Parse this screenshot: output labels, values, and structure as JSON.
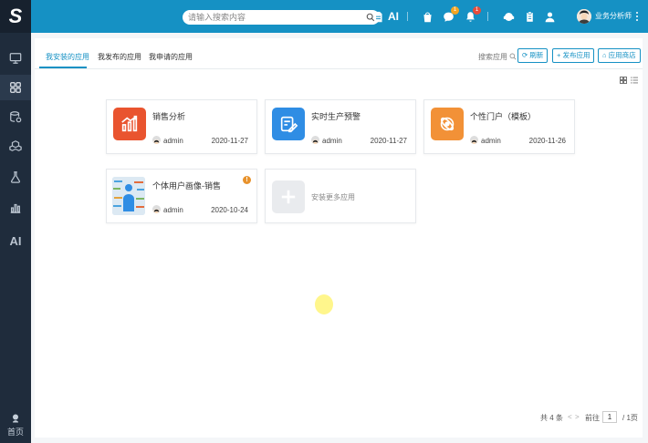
{
  "app": {
    "logo": "S"
  },
  "sidebar": {
    "items": [
      {
        "icon": "monitor-icon"
      },
      {
        "icon": "apps-grid-icon",
        "active": true
      },
      {
        "icon": "database-icon"
      },
      {
        "icon": "cubes-icon"
      },
      {
        "icon": "flask-icon"
      },
      {
        "icon": "bar-chart-icon"
      },
      {
        "icon": "ai-icon",
        "label": "AI"
      }
    ],
    "footer_label": "首页"
  },
  "topbar": {
    "search_placeholder": "请输入搜索内容",
    "ai_label": "AI",
    "message_badge": "1",
    "alert_badge": "1",
    "user_name": "业务分析师"
  },
  "tabs": [
    {
      "label": "我安装的应用",
      "active": true
    },
    {
      "label": "我发布的应用"
    },
    {
      "label": "我申请的应用"
    }
  ],
  "toolbar": {
    "search_label": "搜索应用",
    "refresh_label": "刷新",
    "publish_label": "+ 发布应用",
    "store_label": "应用商店"
  },
  "apps": [
    {
      "name": "销售分析",
      "owner": "admin",
      "date": "2020-11-27",
      "color": "#e9542f"
    },
    {
      "name": "实时生产预警",
      "owner": "admin",
      "date": "2020-11-27",
      "color": "#2f8de4"
    },
    {
      "name": "个性门户（模板）",
      "owner": "admin",
      "date": "2020-11-26",
      "color": "#f29137"
    },
    {
      "name": "个体用户画像-销售",
      "owner": "admin",
      "date": "2020-10-24",
      "warning": true
    }
  ],
  "add_card": {
    "label": "安装更多应用"
  },
  "pagination": {
    "total": "共 4 条",
    "prev": "<",
    "next": ">",
    "goto_label": "前往",
    "page": "1",
    "pages": "/ 1页"
  }
}
